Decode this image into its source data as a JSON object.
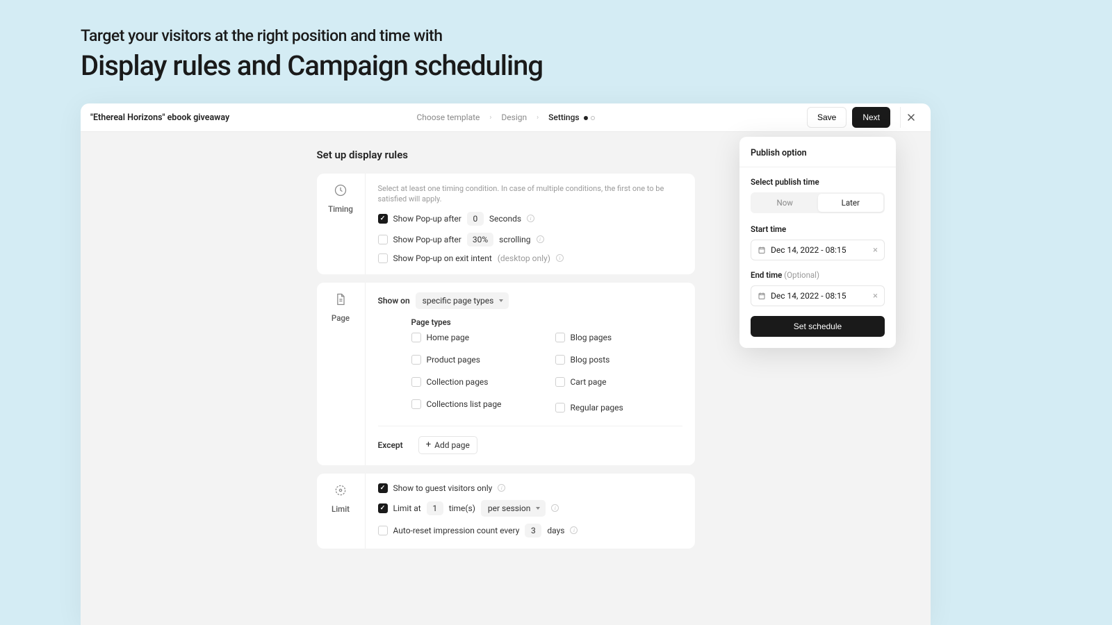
{
  "hero": {
    "subtitle": "Target your visitors at the right position and time with",
    "title": "Display rules and Campaign scheduling"
  },
  "topbar": {
    "title": "\"Ethereal Horizons\" ebook giveaway",
    "steps": [
      "Choose template",
      "Design",
      "Settings"
    ],
    "save": "Save",
    "next": "Next"
  },
  "section": {
    "title": "Set up display rules"
  },
  "timing": {
    "side_label": "Timing",
    "hint": "Select at least one timing condition. In case of multiple conditions, the first one to be satisfied will apply.",
    "after_label": "Show Pop-up after",
    "after_value": "0",
    "after_unit": "Seconds",
    "scroll_label": "Show Pop-up after",
    "scroll_value": "30%",
    "scroll_unit": "scrolling",
    "exit_label": "Show Pop-up on exit intent",
    "exit_suffix": "(desktop only)"
  },
  "page": {
    "side_label": "Page",
    "show_on_label": "Show on",
    "show_on_value": "specific page types",
    "types_header": "Page types",
    "types_left": [
      "Home page",
      "Product pages",
      "Collection pages",
      "Collections list page"
    ],
    "types_right": [
      "Blog pages",
      "Blog posts",
      "Cart page",
      "Regular pages"
    ],
    "except_label": "Except",
    "add_page": "Add page"
  },
  "limit": {
    "side_label": "Limit",
    "guest_label": "Show to guest visitors only",
    "limit_label": "Limit at",
    "limit_value": "1",
    "limit_unit": "time(s)",
    "limit_scope": "per session",
    "reset_label": "Auto-reset impression count every",
    "reset_value": "3",
    "reset_unit": "days"
  },
  "publish": {
    "title": "Publish option",
    "select_label": "Select publish time",
    "now": "Now",
    "later": "Later",
    "start_label": "Start time",
    "start_value": "Dec 14, 2022 - 08:15",
    "end_label": "End time",
    "end_optional": "(Optional)",
    "end_value": "Dec 14, 2022 - 08:15",
    "set_button": "Set schedule"
  }
}
